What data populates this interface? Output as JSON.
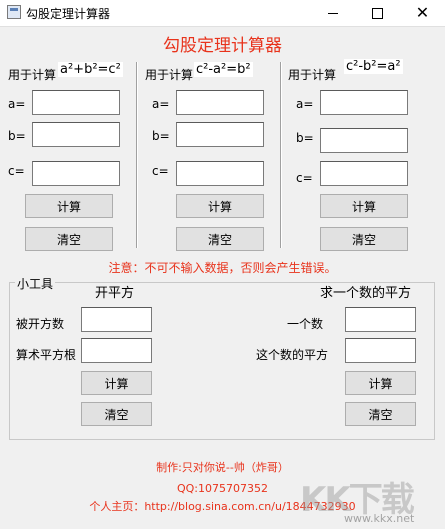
{
  "window": {
    "title": "勾股定理计算器",
    "min_symbol": "",
    "close_symbol": "✕"
  },
  "heading": "勾股定理计算器",
  "panels": [
    {
      "purpose": "用于计算",
      "formula": "a²+b²=c²",
      "a_label": "a=",
      "b_label": "b=",
      "c_label": "c=",
      "calc": "计算",
      "clear": "清空"
    },
    {
      "purpose": "用于计算",
      "formula": "c²-a²=b²",
      "a_label": "a=",
      "b_label": "b=",
      "c_label": "c=",
      "calc": "计算",
      "clear": "清空"
    },
    {
      "purpose": "用于计算",
      "formula": "c²-b²=a²",
      "a_label": "a=",
      "b_label": "b=",
      "c_label": "c=",
      "calc": "计算",
      "clear": "清空"
    }
  ],
  "notice": "注意：不可不输入数据，否则会产生错误。",
  "tools": {
    "group_label": "小工具",
    "sqrt": {
      "title": "开平方",
      "radicand_label": "被开方数",
      "root_label": "算术平方根",
      "calc": "计算",
      "clear": "清空"
    },
    "square": {
      "title": "求一个数的平方",
      "number_label": "一个数",
      "square_label": "这个数的平方",
      "calc": "计算",
      "clear": "清空"
    }
  },
  "footer": {
    "author": "制作:只对你说--帅（炸哥）",
    "qq": "QQ:1075707352",
    "homepage": "个人主页：http://blog.sina.com.cn/u/1844732930"
  },
  "watermark": {
    "text": "KK下载",
    "url": "www.kkx.net"
  }
}
